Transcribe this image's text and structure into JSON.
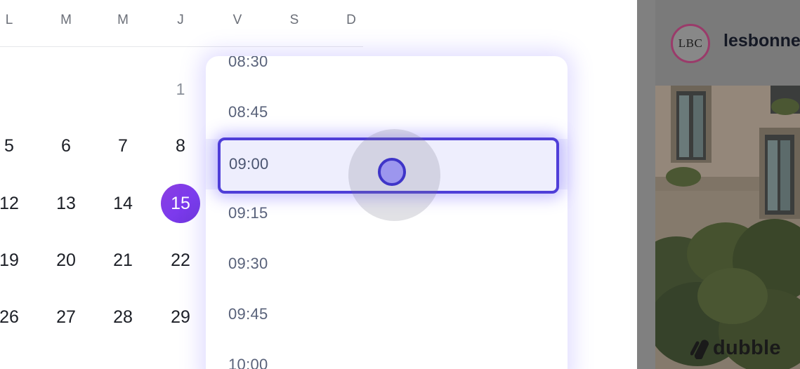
{
  "calendar": {
    "weekdays": [
      "L",
      "M",
      "M",
      "J",
      "V",
      "S",
      "D"
    ],
    "rows": [
      [
        "1"
      ],
      [
        "5",
        "6",
        "7",
        "8"
      ],
      [
        "12",
        "13",
        "14",
        "15"
      ],
      [
        "19",
        "20",
        "21",
        "22"
      ],
      [
        "26",
        "27",
        "28",
        "29"
      ]
    ],
    "selected_day": "15",
    "accent_color": "#7c3aed"
  },
  "time_picker": {
    "options": [
      "08:30",
      "08:45",
      "09:00",
      "09:15",
      "09:30",
      "09:45",
      "10:00"
    ],
    "selected": "09:00",
    "highlight_color": "#4f3ed8"
  },
  "preview": {
    "brand_name": "lesbonne",
    "logo_text": "LBC"
  },
  "watermark": {
    "text": "dubble"
  }
}
